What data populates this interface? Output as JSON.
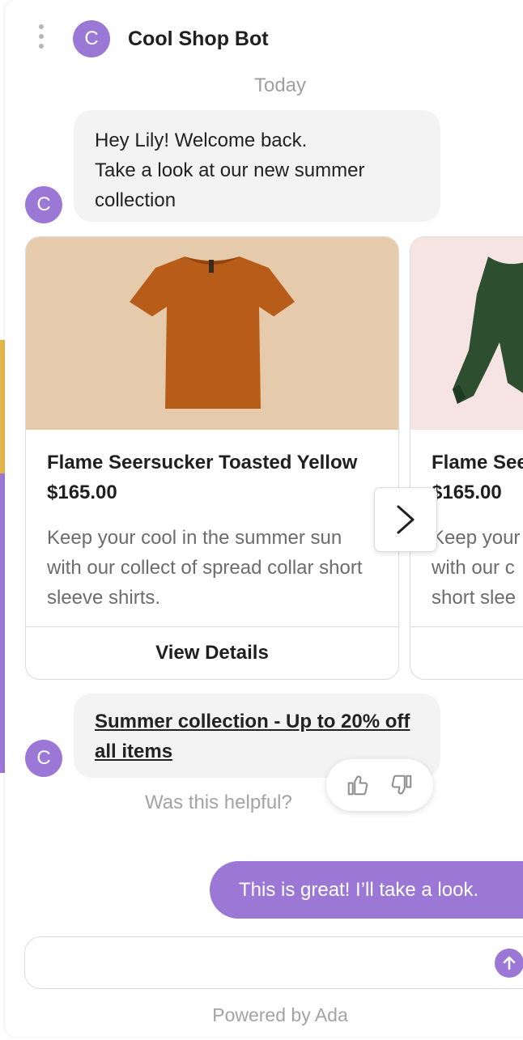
{
  "header": {
    "bot_name": "Cool Shop Bot",
    "avatar_letter": "C"
  },
  "day_label": "Today",
  "messages": {
    "welcome_lines": [
      "Hey Lily! Welcome back.",
      "Take a look at our new summer",
      "collection"
    ],
    "link_message": "Summer collection - Up to 20% off all items",
    "helpful_prompt": "Was this helpful?",
    "user_reply": "This is great! I’ll take a look."
  },
  "carousel": {
    "cards": [
      {
        "title": "Flame Seersucker Toasted Yellow",
        "price": "$165.00",
        "description": "Keep your cool in the summer sun with our collect of spread collar short sleeve shirts.",
        "action": "View Details",
        "image": "orange-tshirt"
      },
      {
        "title": "Flame See",
        "price": "$165.00",
        "description_lines": [
          "Keep your",
          "with our c",
          "short slee"
        ],
        "image": "green-sweater"
      }
    ],
    "next_icon": "chevron-right-icon"
  },
  "composer": {
    "placeholder": "",
    "send_icon": "arrow-up-icon"
  },
  "footer": "Powered by Ada",
  "colors": {
    "accent": "#9b77d6",
    "bubble": "#f3f3f3",
    "card1_bg": "#e5cbab",
    "card2_bg": "#f5e4e2",
    "tshirt": "#b85c1a",
    "sweater": "#2d4e2f"
  }
}
